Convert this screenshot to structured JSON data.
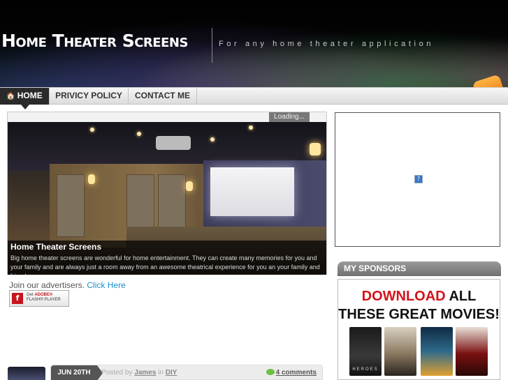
{
  "header": {
    "title": "Home Theater Screens",
    "tagline": "For any home theater application"
  },
  "nav": {
    "items": [
      {
        "label": "HOME",
        "icon": "home-icon",
        "active": true
      },
      {
        "label": "PRIVICY POLICY",
        "active": false
      },
      {
        "label": "CONTACT ME",
        "active": false
      }
    ]
  },
  "slideshow": {
    "loading_text": "Loading...",
    "caption_title": "Home Theater Screens",
    "caption_text": "Big home theater screens are wonderful for home entertainment. They can create many memories for you and your family and are always just a room away from an awesome theatrical experience for you an your family and friends..."
  },
  "advertise": {
    "text": "Join our advertisers.",
    "link": "Click Here"
  },
  "flash_badge": {
    "line1": "Get",
    "brand": "ADOBE®",
    "line2": "FLASH® PLAYER"
  },
  "post": {
    "date": "JUN 20TH",
    "posted_by_label": "Posted by",
    "author": "James",
    "in_label": "in",
    "category": "DIY",
    "comments": "4 comments"
  },
  "sidebar": {
    "sponsors_heading": "MY SPONSORS",
    "promo_word1": "DOWNLOAD",
    "promo_word2": "ALL",
    "promo_line2": "THESE GREAT MOVIES!",
    "poster_label": "HEROES"
  },
  "colors": {
    "nav_active": "#2a2a2a",
    "link": "#1a8fc8",
    "promo_red": "#d4141a"
  }
}
